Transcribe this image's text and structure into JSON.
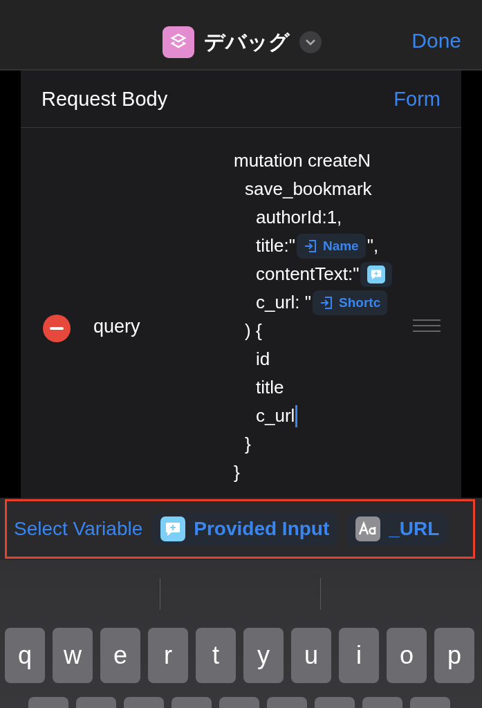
{
  "header": {
    "title": "デバッグ",
    "done": "Done"
  },
  "request_body": {
    "label": "Request Body",
    "mode": "Form"
  },
  "field": {
    "key": "query",
    "lines": [
      {
        "cursor": false,
        "parts": [
          {
            "kind": "text",
            "text": "mutation createN"
          }
        ],
        "children": [
          {
            "cursor": false,
            "parts": [
              {
                "kind": "text",
                "text": "save_bookmark"
              }
            ],
            "children": [
              {
                "cursor": false,
                "parts": [
                  {
                    "kind": "text",
                    "text": "authorId:1,"
                  }
                ]
              },
              {
                "cursor": false,
                "parts": [
                  {
                    "kind": "text",
                    "text": "title:\""
                  },
                  {
                    "kind": "input_token",
                    "text": "Name"
                  },
                  {
                    "kind": "text",
                    "text": "\","
                  }
                ]
              },
              {
                "cursor": false,
                "parts": [
                  {
                    "kind": "text",
                    "text": "contentText:\""
                  },
                  {
                    "kind": "message_token"
                  }
                ]
              },
              {
                "cursor": false,
                "parts": [
                  {
                    "kind": "text",
                    "text": "c_url: \""
                  },
                  {
                    "kind": "input_token",
                    "text": "Shortc"
                  }
                ]
              }
            ]
          },
          {
            "cursor": false,
            "parts": [
              {
                "kind": "text",
                "text": ") {"
              }
            ],
            "children": [
              {
                "cursor": false,
                "parts": [
                  {
                    "kind": "text",
                    "text": "id"
                  }
                ]
              },
              {
                "cursor": false,
                "parts": [
                  {
                    "kind": "text",
                    "text": "title"
                  }
                ]
              },
              {
                "cursor": true,
                "parts": [
                  {
                    "kind": "text",
                    "text": "c_url"
                  }
                ]
              }
            ]
          },
          {
            "cursor": false,
            "parts": [
              {
                "kind": "text",
                "text": "}"
              }
            ]
          }
        ]
      },
      {
        "cursor": false,
        "parts": [
          {
            "kind": "text",
            "text": "}"
          }
        ]
      }
    ]
  },
  "variable_bar": {
    "highlighted": true,
    "label": "Select Variable",
    "variables": [
      {
        "kind": "message",
        "text": "Provided Input"
      },
      {
        "kind": "text",
        "text": "_URL"
      }
    ]
  },
  "keyboard": {
    "keys": [
      "q",
      "w",
      "e",
      "r",
      "t",
      "y",
      "u",
      "i",
      "o",
      "p"
    ]
  }
}
